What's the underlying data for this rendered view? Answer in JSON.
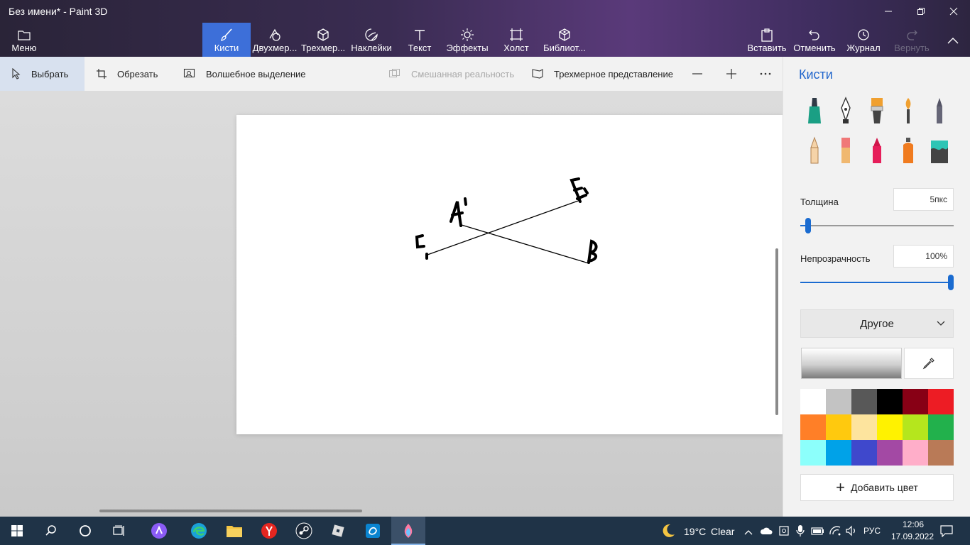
{
  "window": {
    "title": "Без имени* - Paint 3D"
  },
  "ribbon": {
    "menu": "Меню",
    "tools": [
      {
        "label": "Кисти",
        "icon": "brush-icon",
        "active": true
      },
      {
        "label": "Двухмер...",
        "icon": "shapes-2d-icon"
      },
      {
        "label": "Трехмер...",
        "icon": "cube-3d-icon"
      },
      {
        "label": "Наклейки",
        "icon": "sticker-icon"
      },
      {
        "label": "Текст",
        "icon": "text-icon"
      },
      {
        "label": "Эффекты",
        "icon": "effects-icon"
      },
      {
        "label": "Холст",
        "icon": "canvas-icon"
      },
      {
        "label": "Библиот...",
        "icon": "library-icon"
      }
    ],
    "paste": "Вставить",
    "undo": "Отменить",
    "history": "Журнал",
    "redo": "Вернуть"
  },
  "toolbar": {
    "select": "Выбрать",
    "crop": "Обрезать",
    "magic_select": "Волшебное выделение",
    "mixed_reality": "Смешанная реальность",
    "view_3d": "Трехмерное представление"
  },
  "canvas": {
    "labels": {
      "a": "A'",
      "e": "E",
      "c": "C",
      "b": "B"
    }
  },
  "panel": {
    "title": "Кисти",
    "brushes": [
      "marker",
      "calligraphy-pen",
      "oil-brush",
      "watercolor",
      "pixel-pen",
      "pencil",
      "eraser",
      "crayon",
      "spray-can",
      "fill-bucket"
    ],
    "thickness_label": "Толщина",
    "thickness_value": "5пкс",
    "thickness_level": 0.05,
    "opacity_label": "Непрозрачность",
    "opacity_value": "100%",
    "opacity_level": 1.0,
    "finish_dropdown": "Другое",
    "palette": [
      "#ffffff",
      "#c3c3c3",
      "#585858",
      "#000000",
      "#880015",
      "#ed1c24",
      "#ff7f27",
      "#ffc90e",
      "#fde49e",
      "#fff200",
      "#b5e61d",
      "#22b14c",
      "#8cfffb",
      "#00a2e8",
      "#3f48cc",
      "#a349a4",
      "#ffaec9",
      "#b97a57"
    ],
    "add_color": "Добавить цвет"
  },
  "taskbar": {
    "weather_temp": "19°C",
    "weather_desc": "Clear",
    "lang": "РУС",
    "time": "12:06",
    "date": "17.09.2022"
  },
  "colors": {
    "accent": "#3d6fd9",
    "panel_title": "#2266cc",
    "slider": "#1a6bd0"
  }
}
